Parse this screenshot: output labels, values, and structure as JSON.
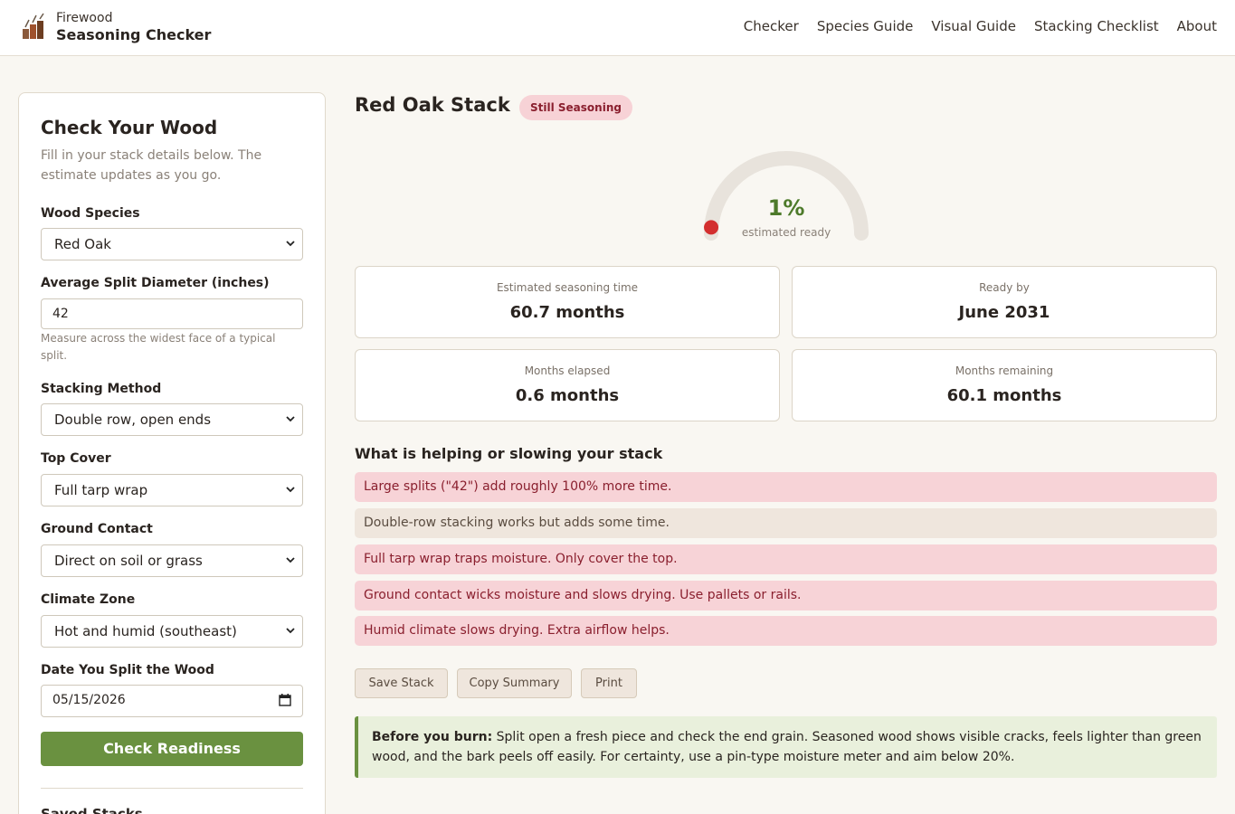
{
  "header": {
    "brand_top": "Firewood",
    "brand_main": "Seasoning Checker",
    "nav": [
      "Checker",
      "Species Guide",
      "Visual Guide",
      "Stacking Checklist",
      "About"
    ]
  },
  "form": {
    "title": "Check Your Wood",
    "intro": "Fill in your stack details below. The estimate updates as you go.",
    "species_label": "Wood Species",
    "species_value": "Red Oak",
    "diameter_label": "Average Split Diameter (inches)",
    "diameter_value": "42",
    "diameter_hint": "Measure across the widest face of a typical split.",
    "stacking_label": "Stacking Method",
    "stacking_value": "Double row, open ends",
    "cover_label": "Top Cover",
    "cover_value": "Full tarp wrap",
    "ground_label": "Ground Contact",
    "ground_value": "Direct on soil or grass",
    "climate_label": "Climate Zone",
    "climate_value": "Hot and humid (southeast)",
    "date_label": "Date You Split the Wood",
    "date_value": "05/15/2026",
    "check_button": "Check Readiness",
    "saved_heading": "Saved Stacks"
  },
  "result": {
    "title": "Red Oak Stack",
    "status_badge": "Still Seasoning",
    "ready_percent": 1,
    "ready_text": "1%",
    "ready_label": "estimated ready",
    "stats": [
      {
        "label": "Estimated seasoning time",
        "value": "60.7 months"
      },
      {
        "label": "Ready by",
        "value": "June 2031"
      },
      {
        "label": "Months elapsed",
        "value": "0.6 months"
      },
      {
        "label": "Months remaining",
        "value": "60.1 months"
      }
    ],
    "factors_heading": "What is helping or slowing your stack",
    "factors": [
      {
        "text": "Large splits (\"42\") add roughly 100% more time.",
        "kind": "bad"
      },
      {
        "text": "Double-row stacking works but adds some time.",
        "kind": "neutral"
      },
      {
        "text": "Full tarp wrap traps moisture. Only cover the top.",
        "kind": "bad"
      },
      {
        "text": "Ground contact wicks moisture and slows drying. Use pallets or rails.",
        "kind": "bad"
      },
      {
        "text": "Humid climate slows drying. Extra airflow helps.",
        "kind": "bad"
      }
    ],
    "buttons": {
      "save": "Save Stack",
      "copy": "Copy Summary",
      "print": "Print"
    },
    "tip_bold": "Before you burn:",
    "tip_text": " Split open a fresh piece and check the end grain. Seasoned wood shows visible cracks, feels lighter than green wood, and the bark peels off easily. For certainty, use a pin-type moisture meter and aim below 20%."
  },
  "colors": {
    "accent_green": "#6a9140",
    "gauge_dot": "#d32f2f",
    "bad_bg": "#f7d3d7",
    "neutral_bg": "#efe6dd"
  }
}
